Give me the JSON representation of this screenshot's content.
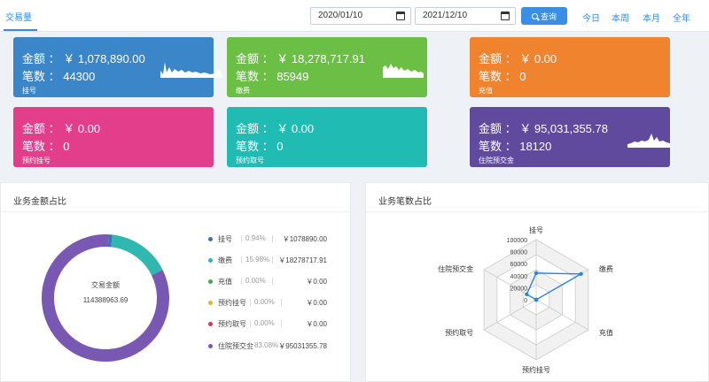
{
  "tabs": {
    "active": "交易量"
  },
  "filters": {
    "start_date": "2020/01/10",
    "end_date": "2021/12/10",
    "query_label": "查询",
    "ranges": [
      "今日",
      "本周",
      "本月",
      "全年"
    ]
  },
  "cards": [
    {
      "amount": "金额 ： ￥ 1,078,890.00",
      "count": "笔数 ： 44300",
      "label": "挂号",
      "color": "#3b86c9"
    },
    {
      "amount": "金额 ： ￥ 18,278,717.91",
      "count": "笔数 ： 85949",
      "label": "缴费",
      "color": "#6bbf45"
    },
    {
      "amount": "金额 ： ￥ 0.00",
      "count": "笔数 ： 0",
      "label": "充值",
      "color": "#f0832e"
    },
    {
      "amount": "金额 ： ￥ 0.00",
      "count": "笔数 ： 0",
      "label": "预约挂号",
      "color": "#e23e8c"
    },
    {
      "amount": "金额 ： ￥ 0.00",
      "count": "笔数 ： 0",
      "label": "预约取号",
      "color": "#20bbb3"
    },
    {
      "amount": "金额 ： ￥ 95,031,355.78",
      "count": "笔数 ： 18120",
      "label": "住院预交金",
      "color": "#5f4a9e"
    }
  ],
  "amount_panel": {
    "title": "业务金额占比",
    "center_label": "交易金额",
    "center_value": "114388963.69",
    "legend": [
      {
        "name": "挂号",
        "pct": "0.94%",
        "value": "￥1078890.00",
        "color": "#3f6fb8"
      },
      {
        "name": "缴费",
        "pct": "15.98%",
        "value": "￥18278717.91",
        "color": "#2fb7b0"
      },
      {
        "name": "充值",
        "pct": "0.00%",
        "value": "￥0.00",
        "color": "#48a846"
      },
      {
        "name": "预约挂号",
        "pct": "0.00%",
        "value": "￥0.00",
        "color": "#e3b52a"
      },
      {
        "name": "预约取号",
        "pct": "0.00%",
        "value": "￥0.00",
        "color": "#d9344f"
      },
      {
        "name": "住院预交金",
        "pct": "83.08%",
        "value": "￥95031355.78",
        "color": "#7858b2"
      }
    ]
  },
  "count_panel": {
    "title": "业务笔数占比"
  },
  "chart_data": [
    {
      "type": "pie",
      "title": "业务金额占比",
      "categories": [
        "挂号",
        "缴费",
        "充值",
        "预约挂号",
        "预约取号",
        "住院预交金"
      ],
      "values": [
        1078890.0,
        18278717.91,
        0,
        0,
        0,
        95031355.78
      ],
      "colors": [
        "#3f6fb8",
        "#2fb7b0",
        "#48a846",
        "#e3b52a",
        "#d9344f",
        "#7858b2"
      ]
    },
    {
      "type": "radar",
      "title": "业务笔数占比",
      "categories": [
        "挂号",
        "缴费",
        "充值",
        "预约挂号",
        "预约取号",
        "住院预交金"
      ],
      "values": [
        44300,
        85949,
        0,
        0,
        0,
        18120
      ],
      "ticks": [
        0,
        20000,
        40000,
        60000,
        80000,
        100000
      ],
      "max": 100000,
      "color": "#2d84d6"
    }
  ]
}
